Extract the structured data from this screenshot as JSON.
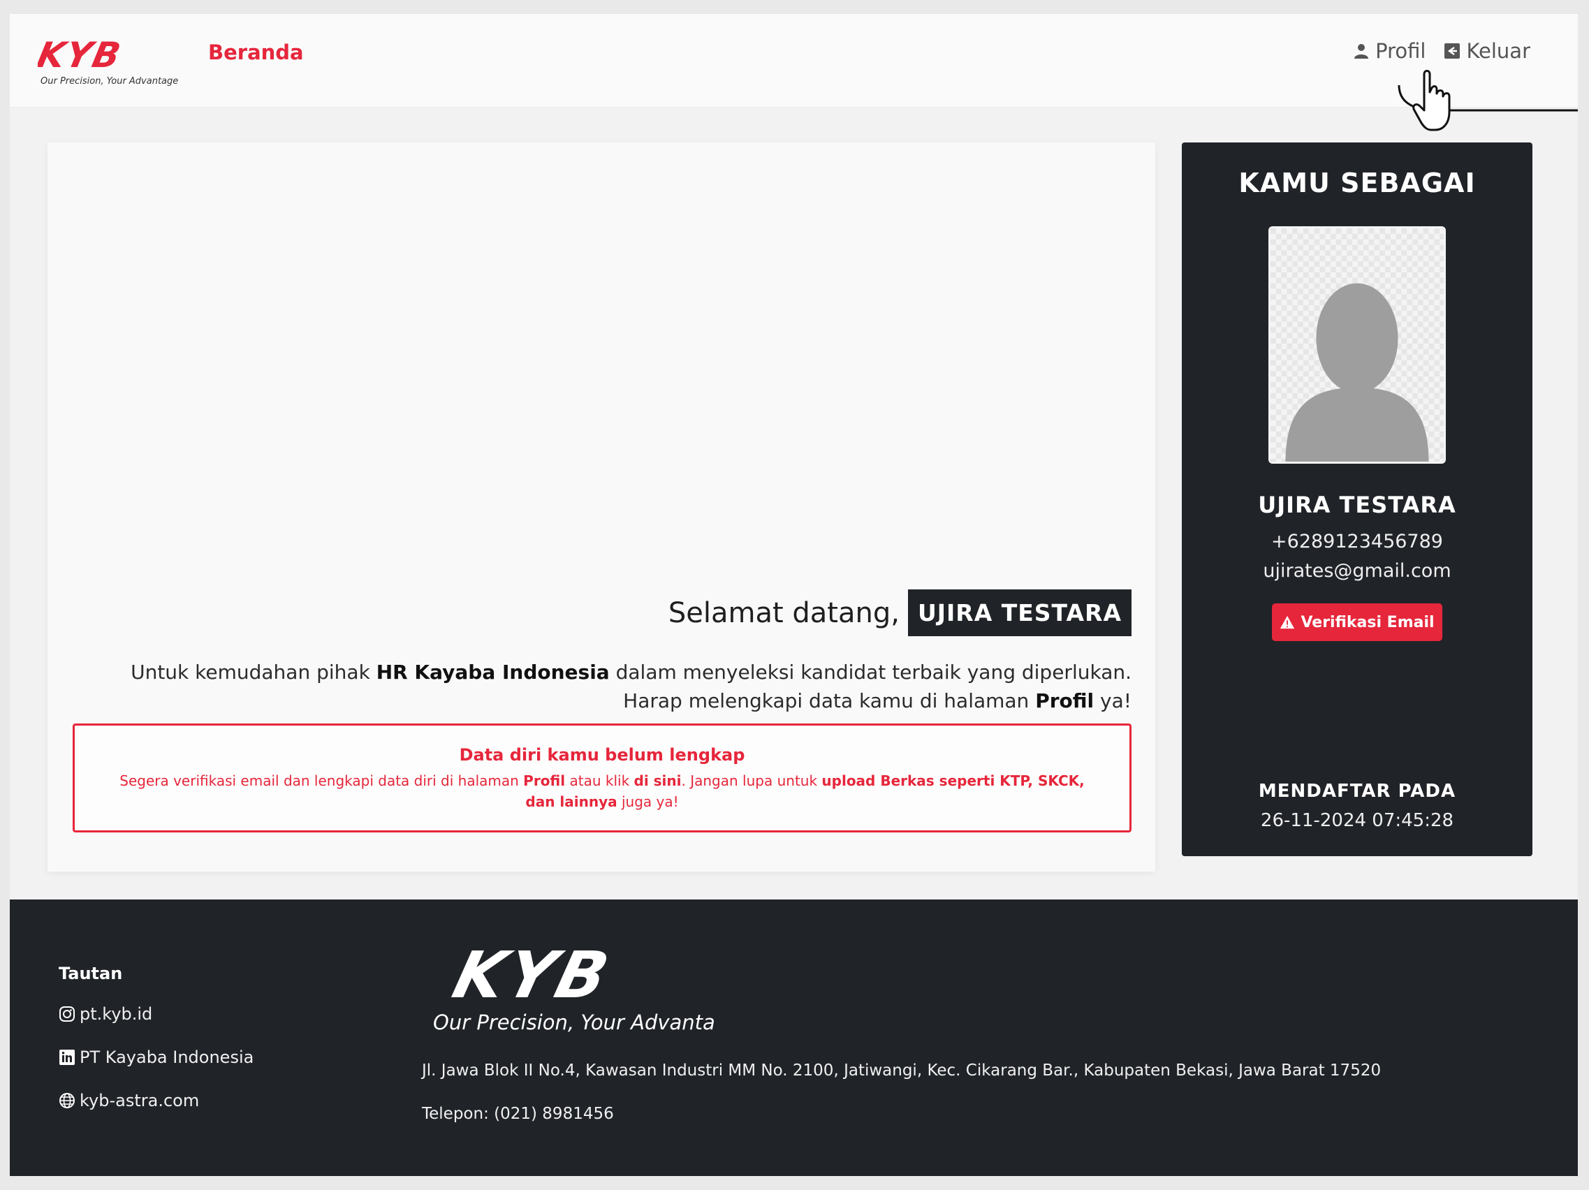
{
  "header": {
    "logo_text": "KYB",
    "logo_tagline": "Our Precision, Your Advantage",
    "nav_beranda": "Beranda",
    "nav_profil": "Profil",
    "nav_keluar": "Keluar"
  },
  "welcome": {
    "greeting": "Selamat datang,",
    "name": "UJIRA TESTARA",
    "intro_prefix": "Untuk kemudahan pihak ",
    "intro_company": "HR Kayaba Indonesia",
    "intro_middle": " dalam menyeleksi kandidat terbaik yang diperlukan. Harap melengkapi data kamu di halaman ",
    "intro_profil": "Profil",
    "intro_suffix": " ya!"
  },
  "alert": {
    "title": "Data diri kamu belum lengkap",
    "part1": "Segera verifikasi email dan lengkapi data diri di halaman ",
    "part2": "Profil",
    "part3": " atau klik ",
    "part4": "di sini",
    "part5": ". Jangan lupa untuk ",
    "part6": "upload Berkas seperti KTP, SKCK, dan lainnya",
    "part7": " juga ya!"
  },
  "profile_card": {
    "title": "KAMU SEBAGAI",
    "name": "UJIRA TESTARA",
    "phone": "+6289123456789",
    "email": "ujirates@gmail.com",
    "verify_label": "Verifikasi Email",
    "registered_label": "MENDAFTAR PADA",
    "registered_date": "26-11-2024 07:45:28"
  },
  "footer": {
    "links_title": "Tautan",
    "links": [
      {
        "label": "pt.kyb.id",
        "icon": "instagram-icon"
      },
      {
        "label": "PT Kayaba Indonesia",
        "icon": "linkedin-icon"
      },
      {
        "label": "kyb-astra.com",
        "icon": "globe-icon"
      }
    ],
    "logo_text": "KYB",
    "logo_tagline": "Our Precision, Your Advantage",
    "address": "Jl. Jawa Blok II No.4, Kawasan Industri MM No. 2100, Jatiwangi, Kec. Cikarang Bar., Kabupaten Bekasi, Jawa Barat 17520",
    "phone": "Telepon: (021) 8981456"
  },
  "colors": {
    "brand_red": "#e6263b",
    "dark": "#202328",
    "background": "#f2f2f2"
  }
}
